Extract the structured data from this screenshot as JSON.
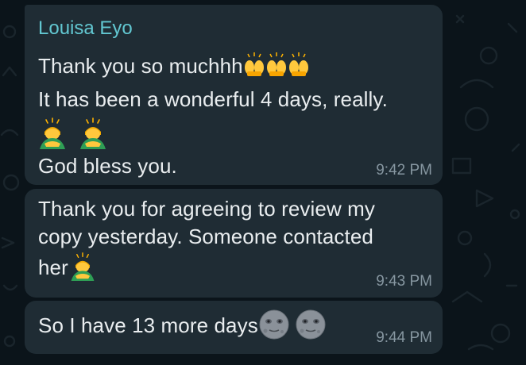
{
  "chat": {
    "messages": [
      {
        "sender": "Louisa Eyo",
        "lines": [
          "Thank you so muchhh",
          "It has been a wonderful 4 days, really.",
          "God bless you."
        ],
        "time": "9:42 PM"
      },
      {
        "lines": [
          "Thank you for agreeing to review my",
          "copy yesterday. Someone contacted",
          "her"
        ],
        "time": "9:43 PM"
      },
      {
        "lines": [
          "So I have 13 more days"
        ],
        "time": "9:44 PM"
      }
    ]
  },
  "icons": {
    "raised_hands": "raising-hands-emoji",
    "bowing": "person-bowing-emoji",
    "new_moon_face": "new-moon-face-emoji"
  },
  "colors": {
    "background": "#0b141a",
    "bubble": "#1f2c34",
    "sender": "#62c7d1",
    "text": "#e9edef",
    "time": "#8696a0"
  }
}
